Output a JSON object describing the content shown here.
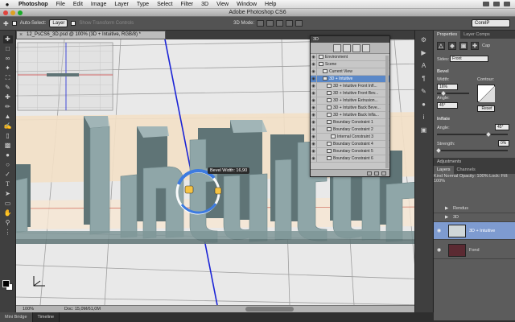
{
  "menubar": {
    "apple": "",
    "items": [
      "Photoshop",
      "File",
      "Edit",
      "Image",
      "Layer",
      "Type",
      "Select",
      "Filter",
      "3D",
      "View",
      "Window",
      "Help"
    ]
  },
  "titlebar": {
    "title": "Adobe Photoshop CS6"
  },
  "options": {
    "auto_select_label": "Auto-Select:",
    "auto_select_value": "Layer",
    "show_transform_label": "Show Transform Controls",
    "mode_label": "3D Mode:",
    "workspace": "CorelP"
  },
  "document": {
    "tab_title": "12_PsCS6_3D.psd @ 100% (3D + Intuitive, RGB/8) *",
    "zoom": "100%",
    "doc_info": "Doc: 15,0M/61,0M",
    "tooltip": "Bevel Width: 16,90",
    "canvas_text": "Intuitive"
  },
  "panel3d": {
    "title": "3D",
    "rows": [
      {
        "label": "Environment",
        "indent": 0,
        "selected": false
      },
      {
        "label": "Scene",
        "indent": 0,
        "selected": false
      },
      {
        "label": "Current View",
        "indent": 1,
        "selected": false
      },
      {
        "label": "3D + Intuitive",
        "indent": 1,
        "selected": true
      },
      {
        "label": "3D + Intuitive Front Infl...",
        "indent": 2,
        "selected": false
      },
      {
        "label": "3D + Intuitive Front Bev...",
        "indent": 2,
        "selected": false
      },
      {
        "label": "3D + Intuitive Extrusion...",
        "indent": 2,
        "selected": false
      },
      {
        "label": "3D + Intuitive Back Beve...",
        "indent": 2,
        "selected": false
      },
      {
        "label": "3D + Intuitive Back Infla...",
        "indent": 2,
        "selected": false
      },
      {
        "label": "Boundary Constraint 1",
        "indent": 2,
        "selected": false
      },
      {
        "label": "Boundary Constraint 2",
        "indent": 2,
        "selected": false
      },
      {
        "label": "Internal Constraint 3",
        "indent": 3,
        "selected": false
      },
      {
        "label": "Boundary Constraint 4",
        "indent": 2,
        "selected": false
      },
      {
        "label": "Boundary Constraint 5",
        "indent": 2,
        "selected": false
      },
      {
        "label": "Boundary Constraint 6",
        "indent": 2,
        "selected": false
      }
    ]
  },
  "properties": {
    "tabs": [
      "Properties",
      "Layer Comps"
    ],
    "cap_label": "Cap",
    "sides_label": "Sides:",
    "sides_value": "Front",
    "bevel_label": "Bevel",
    "width_label": "Width:",
    "width_value": "16%",
    "contour_label": "Contour:",
    "angle_label": "Angle:",
    "angle_value": "45°",
    "reset_label": "Reset",
    "inflate_label": "Inflate",
    "inflate_angle_label": "Angle:",
    "inflate_angle_value": "45°",
    "strength_label": "Strength:",
    "strength_value": "0%"
  },
  "adjustments": {
    "label": "Adjustments"
  },
  "layers": {
    "tabs": [
      "Layers",
      "Channels"
    ],
    "kind_label": "Kind",
    "blend_mode": "Normal",
    "opacity_label": "Opacity:",
    "opacity_value": "100%",
    "lock_label": "Lock:",
    "fill_label": "Fill:",
    "fill_value": "100%",
    "items": [
      {
        "name": "Rendus",
        "type": "folder",
        "selected": false
      },
      {
        "name": "3D",
        "type": "folder",
        "selected": false
      },
      {
        "name": "3D + Intuitive",
        "type": "3d",
        "selected": true
      },
      {
        "name": "Fond",
        "type": "fill",
        "selected": false
      }
    ]
  },
  "bottom_tabs": [
    "Mini Bridge",
    "Timeline"
  ],
  "colors": {
    "selection": "#5a88c8",
    "text3d": "#8fa6a8",
    "axis_blue": "#1a23d6"
  }
}
